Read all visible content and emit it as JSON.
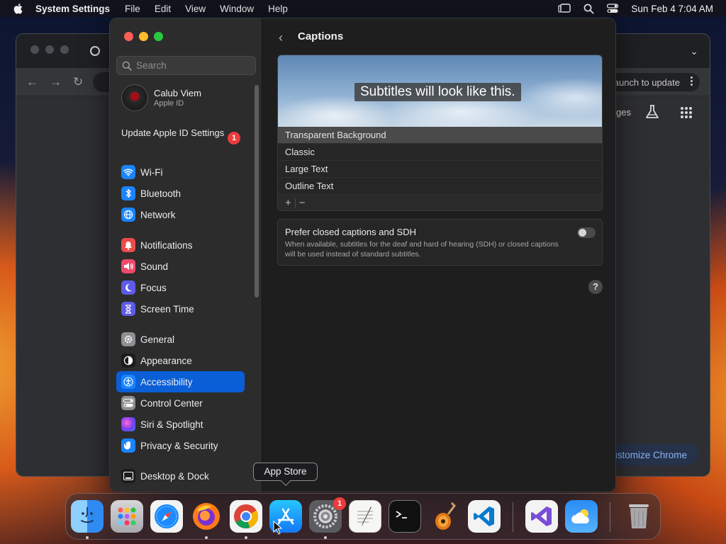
{
  "menubar": {
    "app_name": "System Settings",
    "items": [
      "File",
      "Edit",
      "View",
      "Window",
      "Help"
    ],
    "datetime": "Sun Feb 4  7:04 AM"
  },
  "chrome": {
    "update_text": "Relaunch to update",
    "partial_label": "ges",
    "customize_text": "Customize Chrome"
  },
  "sidebar": {
    "search_placeholder": "Search",
    "account": {
      "name": "Calub Viem",
      "sub": "Apple ID"
    },
    "update": {
      "label": "Update Apple ID Settings",
      "badge": "1"
    },
    "items": [
      {
        "label": "Wi-Fi",
        "icon": "wifi-icon",
        "color": "#1a84ff"
      },
      {
        "label": "Bluetooth",
        "icon": "bluetooth-icon",
        "color": "#1a84ff"
      },
      {
        "label": "Network",
        "icon": "globe-icon",
        "color": "#1a84ff"
      },
      {
        "label": "Notifications",
        "icon": "bell-icon",
        "color": "#ee4a4a"
      },
      {
        "label": "Sound",
        "icon": "speaker-icon",
        "color": "#ee4a6b"
      },
      {
        "label": "Focus",
        "icon": "moon-icon",
        "color": "#5e5ce6"
      },
      {
        "label": "Screen Time",
        "icon": "hourglass-icon",
        "color": "#5e5ce6"
      },
      {
        "label": "General",
        "icon": "gear-icon",
        "color": "#8e8e93"
      },
      {
        "label": "Appearance",
        "icon": "appearance-icon",
        "color": "#1c1c1e"
      },
      {
        "label": "Accessibility",
        "icon": "accessibility-icon",
        "color": "#1a84ff"
      },
      {
        "label": "Control Center",
        "icon": "control-center-icon",
        "color": "#8e8e93"
      },
      {
        "label": "Siri & Spotlight",
        "icon": "siri-icon",
        "color": "#c9459a"
      },
      {
        "label": "Privacy & Security",
        "icon": "hand-icon",
        "color": "#1a84ff"
      },
      {
        "label": "Desktop & Dock",
        "icon": "dock-icon",
        "color": "#1c1c1e"
      }
    ],
    "selected": "Accessibility"
  },
  "content": {
    "title": "Captions",
    "preview_text": "Subtitles will look like this.",
    "styles": [
      "Transparent Background",
      "Classic",
      "Large Text",
      "Outline Text"
    ],
    "selected_style": "Transparent Background",
    "add_label": "+",
    "remove_label": "−",
    "sdh": {
      "title": "Prefer closed captions and SDH",
      "description": "When available, subtitles for the deaf and hard of hearing (SDH) or closed captions will be used instead of standard subtitles.",
      "enabled": false
    },
    "help_label": "?"
  },
  "tooltip": "App Store",
  "dock": {
    "apps": [
      "Finder",
      "Launchpad",
      "Safari",
      "Firefox",
      "Google Chrome",
      "App Store",
      "System Settings",
      "TextEdit",
      "Terminal",
      "GarageBand",
      "Visual Studio Code",
      "Visual Studio",
      "Weather",
      "Trash"
    ],
    "system_settings_badge": "1"
  }
}
